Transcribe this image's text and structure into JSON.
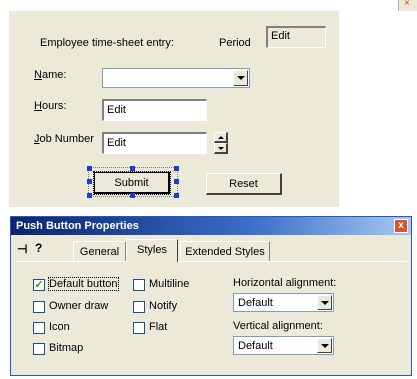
{
  "dialog": {
    "header_label": "Employee time-sheet entry:",
    "period_label": "Period",
    "period_value": "Edit",
    "name_label": "Name:",
    "name_value": "",
    "hours_label": "Hours:",
    "hours_value": "Edit",
    "job_label": "Job Number",
    "job_value": "Edit",
    "submit_label": "Submit",
    "reset_label": "Reset"
  },
  "scroll_close": "×",
  "properties": {
    "title": "Push Button Properties",
    "close_glyph": "x",
    "pin_glyph": "⊣",
    "help_glyph": "?",
    "tabs": [
      {
        "label": "General",
        "active": false
      },
      {
        "label": "Styles",
        "active": true
      },
      {
        "label": "Extended Styles",
        "active": false
      }
    ],
    "checkboxes": [
      {
        "label": "Default button",
        "checked": true
      },
      {
        "label": "Owner draw",
        "checked": false
      },
      {
        "label": "Icon",
        "checked": false
      },
      {
        "label": "Bitmap",
        "checked": false
      },
      {
        "label": "Multiline",
        "checked": false
      },
      {
        "label": "Notify",
        "checked": false
      },
      {
        "label": "Flat",
        "checked": false
      }
    ],
    "check_glyph": "✓",
    "horizontal_label": "Horizontal alignment:",
    "horizontal_value": "Default",
    "vertical_label": "Vertical alignment:",
    "vertical_value": "Default"
  },
  "colors": {
    "dialog_face": "#ECE9D8",
    "title_bar": "#0a246a",
    "selection_handle": "#1a3bd6"
  }
}
